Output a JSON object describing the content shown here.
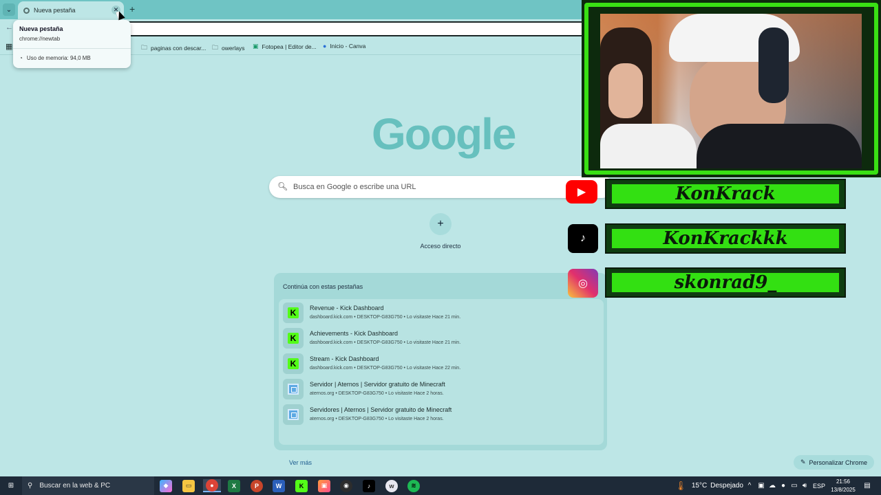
{
  "tab": {
    "title": "Nueva pestaña",
    "close": "✕",
    "new": "+"
  },
  "hovercard": {
    "title": "Nueva pestaña",
    "url": "chrome://newtab",
    "memory": "Uso de memoria: 94,0 MB"
  },
  "bookmarks": [
    {
      "label": "paginas con descar...",
      "icon": "folder-icon"
    },
    {
      "label": "owerlays",
      "icon": "folder-icon"
    },
    {
      "label": "Fotopea | Editor de...",
      "icon": "photopea-icon"
    },
    {
      "label": "Inicio - Canva",
      "icon": "canva-icon"
    }
  ],
  "logo": "Google",
  "search": {
    "placeholder": "Busca en Google o escribe una URL"
  },
  "shortcut": {
    "plus": "+",
    "label": "Acceso directo"
  },
  "continue": {
    "heading": "Continúa con estas pestañas",
    "items": [
      {
        "title": "Revenue - Kick Dashboard",
        "sub": "dashboard.kick.com • DESKTOP-G83G750 • Lo visitaste Hace 21 min.",
        "icon": "kick"
      },
      {
        "title": "Achievements - Kick Dashboard",
        "sub": "dashboard.kick.com • DESKTOP-G83G750 • Lo visitaste Hace 21 min.",
        "icon": "kick"
      },
      {
        "title": "Stream - Kick Dashboard",
        "sub": "dashboard.kick.com • DESKTOP-G83G750 • Lo visitaste Hace 22 min.",
        "icon": "kick"
      },
      {
        "title": "Servidor | Aternos | Servidor gratuito de Minecraft",
        "sub": "aternos.org • DESKTOP-G83G750 • Lo visitaste Hace 2 horas.",
        "icon": "aternos"
      },
      {
        "title": "Servidores | Aternos | Servidor gratuito de Minecraft",
        "sub": "aternos.org • DESKTOP-G83G750 • Lo visitaste Hace 2 horas.",
        "icon": "aternos"
      }
    ],
    "more": "Ver más"
  },
  "personalize": "Personalizar Chrome",
  "overlay": {
    "youtube": "KonKrack",
    "tiktok": "KonKrackkk",
    "instagram": "skonrad9_"
  },
  "taskbar": {
    "search": "Buscar en la web & PC",
    "weather_temp": "15°C",
    "weather_desc": "Despejado",
    "lang": "ESP",
    "time": "21:56",
    "date": "13/8/2025"
  },
  "colors": {
    "accent": "#6fc4c4",
    "kick_green": "#53fc18",
    "overlay_green": "#33e012"
  }
}
